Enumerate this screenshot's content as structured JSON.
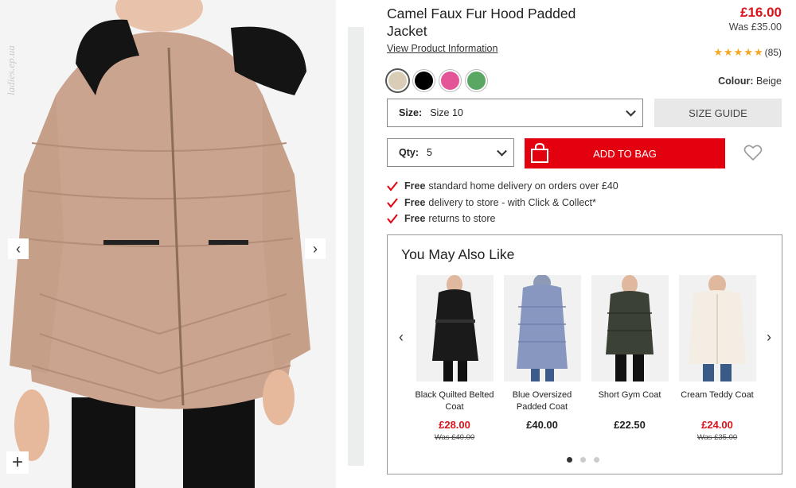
{
  "gallery": {
    "watermark": "ladies.ep.ua",
    "prev_icon": "chevron-left-icon",
    "next_icon": "chevron-right-icon",
    "zoom_icon": "plus-icon"
  },
  "product": {
    "title": "Camel Faux Fur Hood Padded Jacket",
    "price": "£16.00",
    "was_price": "Was £35.00",
    "view_info": "View Product Information",
    "rating_stars": "★★★★★",
    "review_count": "(85)",
    "colour_label": "Colour:",
    "colour_value": "Beige",
    "swatches": [
      {
        "name": "beige",
        "color": "#d9cdb8"
      },
      {
        "name": "black",
        "color": "#000000"
      },
      {
        "name": "pink",
        "color": "#e35597"
      },
      {
        "name": "green",
        "color": "#5aa764"
      }
    ],
    "size_label": "Size:",
    "size_value": "Size 10",
    "size_guide": "SIZE GUIDE",
    "qty_label": "Qty:",
    "qty_value": "5",
    "add_to_bag": "ADD TO BAG",
    "accent_color": "#e3000f"
  },
  "benefits": [
    {
      "bold": "Free",
      "text": "standard home delivery on orders over £40"
    },
    {
      "bold": "Free",
      "text": "delivery to store - with Click & Collect*"
    },
    {
      "bold": "Free",
      "text": "returns to store"
    }
  ],
  "recommendations": {
    "title": "You May Also Like",
    "items": [
      {
        "name": "Black Quilted Belted Coat",
        "price": "£28.00",
        "was": "Was £40.00",
        "sale": true
      },
      {
        "name": "Blue Oversized Padded Coat",
        "price": "£40.00",
        "was": "",
        "sale": false
      },
      {
        "name": "Short Gym Coat",
        "price": "£22.50",
        "was": "",
        "sale": false
      },
      {
        "name": "Cream Teddy Coat",
        "price": "£24.00",
        "was": "Was £35.00",
        "sale": true
      }
    ]
  }
}
